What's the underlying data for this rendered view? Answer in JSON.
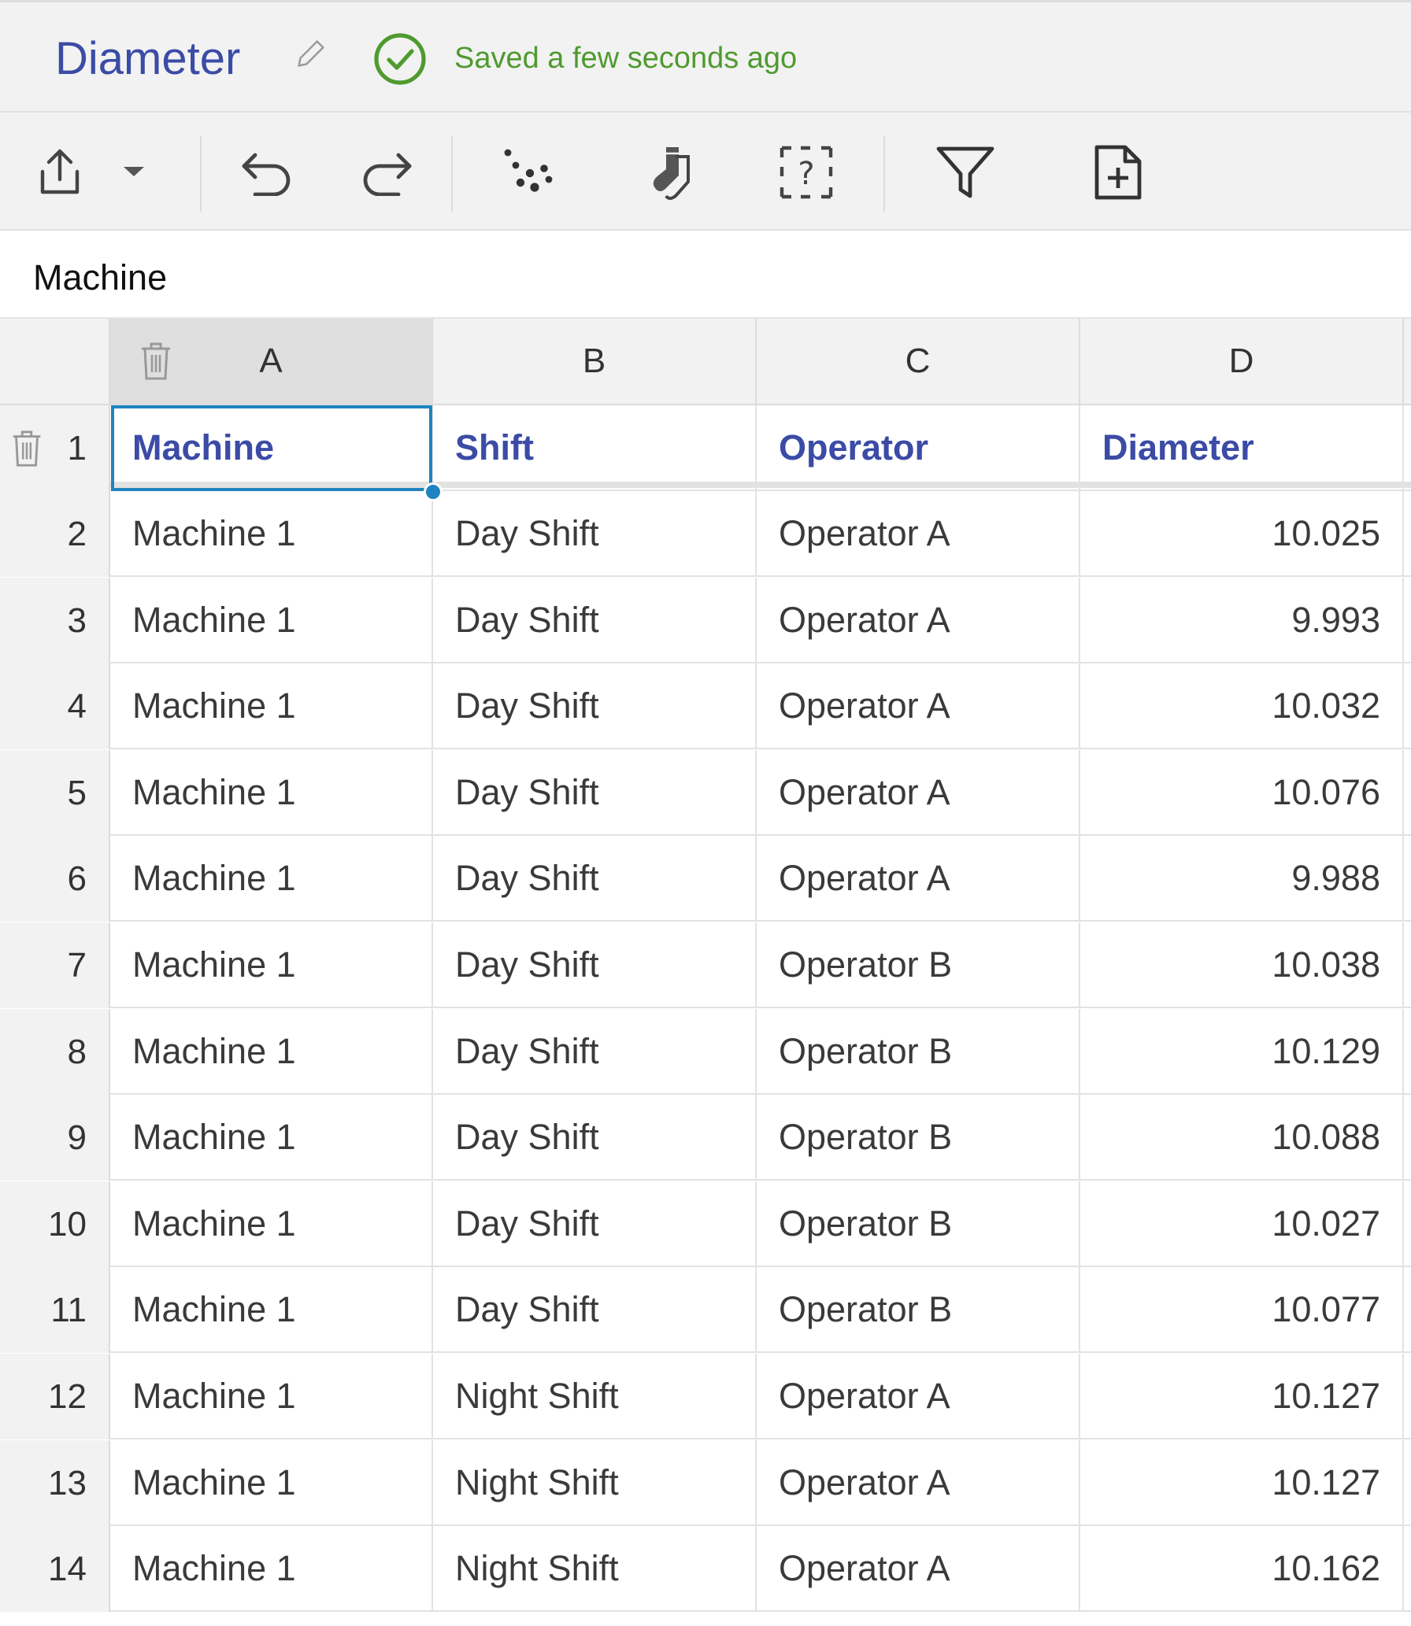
{
  "header": {
    "title": "Diameter",
    "saved_status": "Saved a few seconds ago",
    "status_color": "#4f9a2f",
    "title_color": "#3b4ba6"
  },
  "toolbar": {
    "icons": [
      "export-icon",
      "dropdown-arrow-icon",
      "undo-icon",
      "redo-icon",
      "scatter-dots-icon",
      "socks-icon",
      "help-bracket-icon",
      "filter-icon",
      "add-document-icon"
    ]
  },
  "formula_bar": {
    "value": "Machine"
  },
  "columns": [
    "A",
    "B",
    "C",
    "D"
  ],
  "header_row": {
    "row_num": "1",
    "cells": [
      "Machine",
      "Shift",
      "Operator",
      "Diameter"
    ]
  },
  "rows": [
    {
      "n": "2",
      "machine": "Machine 1",
      "shift": "Day Shift",
      "operator": "Operator A",
      "diameter": "10.025"
    },
    {
      "n": "3",
      "machine": "Machine 1",
      "shift": "Day Shift",
      "operator": "Operator A",
      "diameter": "9.993"
    },
    {
      "n": "4",
      "machine": "Machine 1",
      "shift": "Day Shift",
      "operator": "Operator A",
      "diameter": "10.032"
    },
    {
      "n": "5",
      "machine": "Machine 1",
      "shift": "Day Shift",
      "operator": "Operator A",
      "diameter": "10.076"
    },
    {
      "n": "6",
      "machine": "Machine 1",
      "shift": "Day Shift",
      "operator": "Operator A",
      "diameter": "9.988"
    },
    {
      "n": "7",
      "machine": "Machine 1",
      "shift": "Day Shift",
      "operator": "Operator B",
      "diameter": "10.038"
    },
    {
      "n": "8",
      "machine": "Machine 1",
      "shift": "Day Shift",
      "operator": "Operator B",
      "diameter": "10.129"
    },
    {
      "n": "9",
      "machine": "Machine 1",
      "shift": "Day Shift",
      "operator": "Operator B",
      "diameter": "10.088"
    },
    {
      "n": "10",
      "machine": "Machine 1",
      "shift": "Day Shift",
      "operator": "Operator B",
      "diameter": "10.027"
    },
    {
      "n": "11",
      "machine": "Machine 1",
      "shift": "Day Shift",
      "operator": "Operator B",
      "diameter": "10.077"
    },
    {
      "n": "12",
      "machine": "Machine 1",
      "shift": "Night Shift",
      "operator": "Operator A",
      "diameter": "10.127"
    },
    {
      "n": "13",
      "machine": "Machine 1",
      "shift": "Night Shift",
      "operator": "Operator A",
      "diameter": "10.127"
    },
    {
      "n": "14",
      "machine": "Machine 1",
      "shift": "Night Shift",
      "operator": "Operator A",
      "diameter": "10.162"
    }
  ]
}
